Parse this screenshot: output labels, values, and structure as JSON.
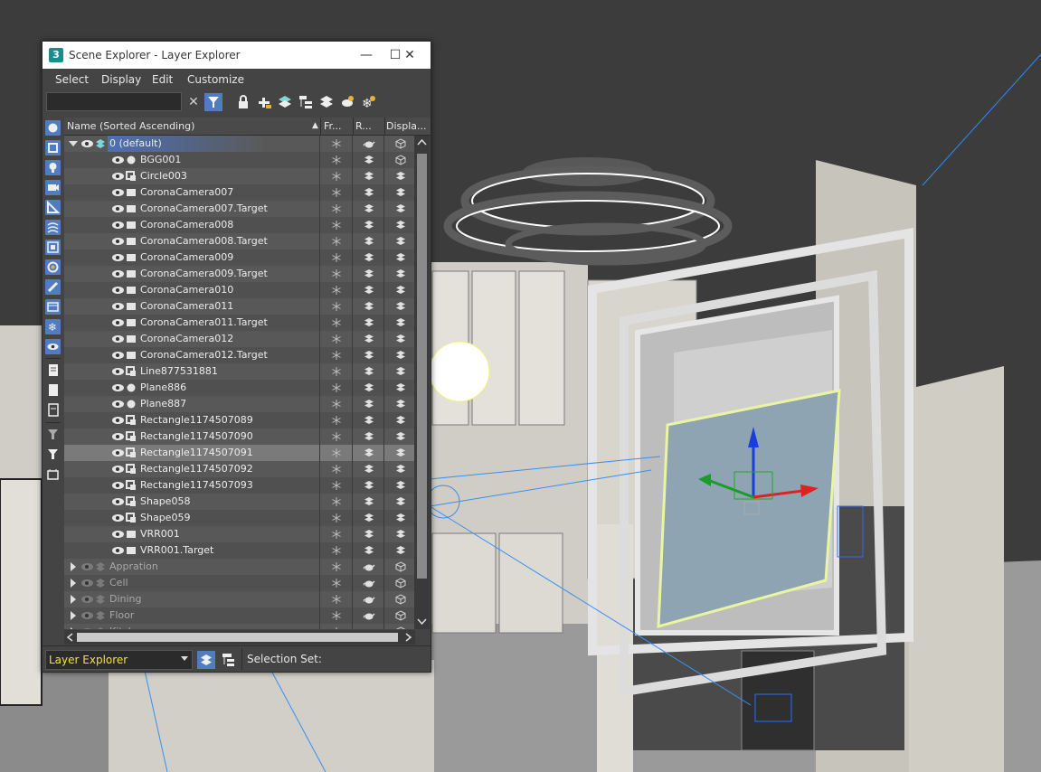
{
  "window": {
    "title": "Scene Explorer - Layer Explorer",
    "app_icon_text": "3",
    "minimize_glyph": "—",
    "maximize_glyph": "☐",
    "close_glyph": "✕"
  },
  "menu": [
    "Select",
    "Display",
    "Edit",
    "Customize"
  ],
  "toolbar": {
    "search_value": "",
    "clear_glyph": "✕",
    "icons": [
      "filter-icon",
      "lock-icon",
      "add-layer-icon",
      "layers-stack-icon",
      "hierarchy-icon",
      "layer-icon",
      "teapot-layer-icon",
      "freeze-layer-icon"
    ]
  },
  "sidebar_icons": [
    "geometry-icon",
    "shapes-icon",
    "lights-icon",
    "cameras-icon",
    "helpers-icon",
    "spacewarps-icon",
    "groups-icon",
    "xrefs-icon",
    "bones-icon",
    "containers-icon",
    "frozen-icon",
    "hidden-icon",
    "select-all-icon",
    "select-none-icon",
    "invert-icon",
    "filter-funnel-icon",
    "filter-icon",
    "display-children-icon"
  ],
  "columns": {
    "name": "Name (Sorted Ascending)",
    "sort_glyph": "▲",
    "frozen": "Fr...",
    "renderable": "R...",
    "display": "Displa..."
  },
  "rows": [
    {
      "name": "0 (default)",
      "kind": "layer-expanded",
      "icon": "layers-icon",
      "selected_layer": true
    },
    {
      "name": "BGG001",
      "kind": "object",
      "icon": "sphere-icon"
    },
    {
      "name": "Circle003",
      "kind": "object",
      "icon": "shape-icon"
    },
    {
      "name": "CoronaCamera007",
      "kind": "object",
      "icon": "camera-icon"
    },
    {
      "name": "CoronaCamera007.Target",
      "kind": "object",
      "icon": "camera-icon"
    },
    {
      "name": "CoronaCamera008",
      "kind": "object",
      "icon": "camera-icon"
    },
    {
      "name": "CoronaCamera008.Target",
      "kind": "object",
      "icon": "camera-icon"
    },
    {
      "name": "CoronaCamera009",
      "kind": "object",
      "icon": "camera-icon"
    },
    {
      "name": "CoronaCamera009.Target",
      "kind": "object",
      "icon": "camera-icon"
    },
    {
      "name": "CoronaCamera010",
      "kind": "object",
      "icon": "camera-icon"
    },
    {
      "name": "CoronaCamera011",
      "kind": "object",
      "icon": "camera-icon"
    },
    {
      "name": "CoronaCamera011.Target",
      "kind": "object",
      "icon": "camera-icon"
    },
    {
      "name": "CoronaCamera012",
      "kind": "object",
      "icon": "camera-icon"
    },
    {
      "name": "CoronaCamera012.Target",
      "kind": "object",
      "icon": "camera-icon"
    },
    {
      "name": "Line877531881",
      "kind": "object",
      "icon": "shape-icon"
    },
    {
      "name": "Plane886",
      "kind": "object",
      "icon": "sphere-icon"
    },
    {
      "name": "Plane887",
      "kind": "object",
      "icon": "sphere-icon"
    },
    {
      "name": "Rectangle1174507089",
      "kind": "object",
      "icon": "shape-icon"
    },
    {
      "name": "Rectangle1174507090",
      "kind": "object",
      "icon": "shape-icon"
    },
    {
      "name": "Rectangle1174507091",
      "kind": "object",
      "icon": "shape-icon",
      "highlighted": true
    },
    {
      "name": "Rectangle1174507092",
      "kind": "object",
      "icon": "shape-icon"
    },
    {
      "name": "Rectangle1174507093",
      "kind": "object",
      "icon": "shape-icon"
    },
    {
      "name": "Shape058",
      "kind": "object",
      "icon": "shape-icon"
    },
    {
      "name": "Shape059",
      "kind": "object",
      "icon": "shape-icon"
    },
    {
      "name": "VRR001",
      "kind": "object",
      "icon": "camera-icon"
    },
    {
      "name": "VRR001.Target",
      "kind": "object",
      "icon": "camera-icon"
    },
    {
      "name": "Appration",
      "kind": "layer-collapsed",
      "icon": "layers-icon"
    },
    {
      "name": "Cell",
      "kind": "layer-collapsed",
      "icon": "layers-icon"
    },
    {
      "name": "Dining",
      "kind": "layer-collapsed",
      "icon": "layers-icon"
    },
    {
      "name": "Floor",
      "kind": "layer-collapsed",
      "icon": "layers-icon"
    },
    {
      "name": "Kitchen",
      "kind": "layer-collapsed",
      "icon": "layers-icon"
    }
  ],
  "status": {
    "explorer_select": "Layer Explorer",
    "selection_set_label": "Selection Set:"
  },
  "colors": {
    "accent": "#4f7dbf",
    "yellow_text": "#f2e23b",
    "selected_row": "#7a7a7a"
  }
}
